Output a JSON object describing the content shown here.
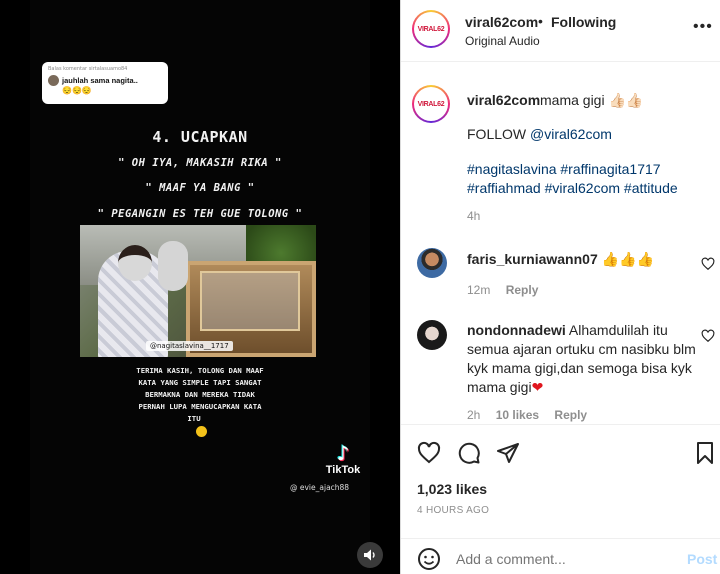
{
  "video": {
    "reply_label": "Balas komentar sirtalasuamo84",
    "reply_text": "jauhlah sama nagita..",
    "reply_emoji": "😔😔😔",
    "heading": "4. UCAPKAN",
    "quote1": "\" OH IYA, MAKASIH RIKA \"",
    "quote2": "\" MAAF YA BANG \"",
    "quote3": "\" PEGANGIN ES TEH GUE TOLONG \"",
    "clip_tag": "@nagitaslavina__1717",
    "body_lines": [
      "TERIMA KASIH, TOLONG DAN MAAF",
      "KATA YANG SIMPLE TAPI SANGAT",
      "BERMAKNA DAN MEREKA TIDAK",
      "PERNAH LUPA MENGUCAPKAN KATA",
      "ITU"
    ],
    "tiktok_name": "TikTok",
    "tiktok_user": "@ evie_ajach88",
    "mute_icon": "speaker-icon"
  },
  "header": {
    "logo_text": "VIRAL62",
    "username": "viral62com",
    "dot": "•",
    "follow_status": "Following",
    "audio": "Original Audio",
    "more": "•••"
  },
  "caption": {
    "logo_text": "VIRAL62",
    "username": "viral62com",
    "text": "mama gigi 👍🏻👍🏻",
    "follow_prefix": "FOLLOW ",
    "follow_mention": "@viral62com",
    "tags_line1": "#nagitaslavina #raffinagita1717",
    "tags_line2": "#raffiahmad #viral62com #attitude",
    "time": "4h"
  },
  "comments": [
    {
      "username": "faris_kurniawann07",
      "text": "👍👍👍",
      "time": "12m",
      "reply": "Reply"
    },
    {
      "username": "nondonnadewi",
      "text": "Alhamdulilah itu semua ajaran ortuku cm nasibku blm kyk mama gigi,dan semoga bisa kyk mama gigi",
      "heart": "❤",
      "time": "2h",
      "likes": "10 likes",
      "reply": "Reply"
    }
  ],
  "stats": {
    "likes": "1,023 likes",
    "ago": "4 HOURS AGO"
  },
  "add_comment": {
    "placeholder": "Add a comment...",
    "post": "Post"
  },
  "colors": {
    "link": "#00376b",
    "muted": "#8e8e8e",
    "post_disabled": "#b3dbff"
  }
}
